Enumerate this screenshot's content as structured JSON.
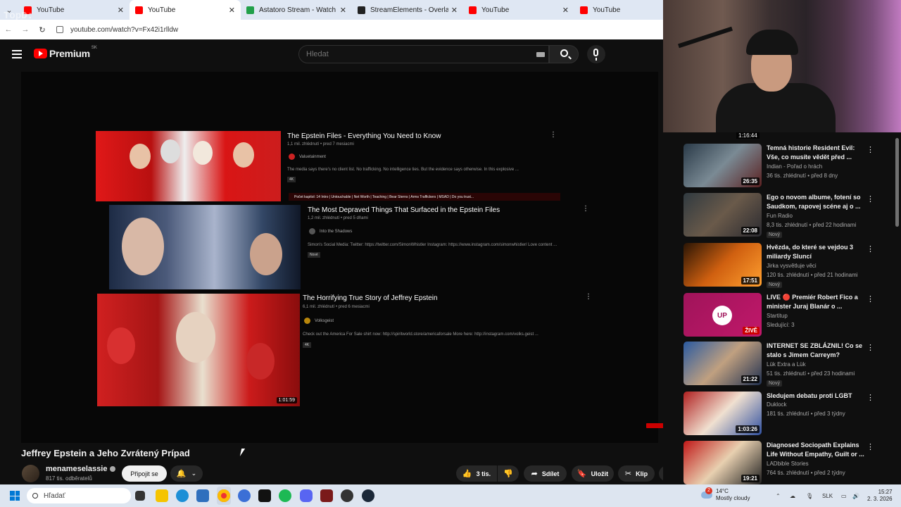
{
  "browser": {
    "tabs": [
      {
        "label": "YouTube",
        "favicon": "youtube-icon"
      },
      {
        "label": "YouTube",
        "favicon": "youtube-icon"
      },
      {
        "label": "Astatoro Stream - Watch Live o",
        "favicon": "kick-icon"
      },
      {
        "label": "StreamElements - Overlays",
        "favicon": "streamelements-icon"
      },
      {
        "label": "YouTube",
        "favicon": "youtube-icon"
      },
      {
        "label": "YouTube",
        "favicon": "youtube-icon"
      }
    ],
    "url": "youtube.com/watch?v=Fx42i1rlldw",
    "watermark": "TopD:"
  },
  "header": {
    "logo_text": "Premium",
    "region": "SK",
    "search_placeholder": "Hledat"
  },
  "player": {
    "videos": [
      {
        "title": "The Epstein Files - Everything You Need to Know",
        "meta": "1,1 mil. zhlédnutí • pred 7 mesiacmi",
        "channel": "Valuetainment",
        "desc": "The media says there's no client list. No trafficking. No intelligence ties. But the evidence says otherwise. In this explosive ...",
        "badge": "4K",
        "chapters": "Počet kapitol: 14  Intro | Untouchable | Net Worth | Teaching | Bear Sterns | Arms Traffickers | MSAD | Do you trust..."
      },
      {
        "title": "The Most Depraved Things That Surfaced in the Epstein Files",
        "meta": "1,2 mil. zhlédnutí • pred 5 dňami",
        "channel": "Into the Shadows",
        "desc": "Simon's Social Media: Twitter: https://twitter.com/SimonWhistler Instagram: https://www.instagram.com/simonwhistler/ Love content ...",
        "badge": "Nové"
      },
      {
        "title": "The Horrifying True Story of Jeffrey Epstein",
        "meta": "6,1 mil. zhlédnutí • pred 6 mesiacmi",
        "channel": "Volksgeist",
        "desc": "Check out the America For Sale shirt now: http://spiritworld.store/americaforsale More here: http://instagram.com/volks.geist ...",
        "badge": "4K",
        "duration": "1:01:59"
      }
    ]
  },
  "video": {
    "title": "Jeffrey Epstein a Jeho Zvrátený Prípad",
    "channel": "menameselassie",
    "subscribers": "817 tis. odběratelů",
    "join_label": "Připojit se",
    "likes": "3 tis.",
    "share_label": "Sdílet",
    "save_label": "Uložit",
    "clip_label": "Klip"
  },
  "sidebar": {
    "top_duration": "1:16:44",
    "items": [
      {
        "title": "Temná historie Resident Evil: Vše, co musíte vědět před ...",
        "channel": "Indian - Pořad o hrách",
        "meta": "36 tis. zhlédnutí • před 8 dny",
        "duration": "26:35",
        "new": ""
      },
      {
        "title": "Ego o novom albume, fotení so Saudkom, rapovej scéne aj o ...",
        "channel": "Fun Radio",
        "meta": "8,3 tis. zhlédnutí • před 22 hodinami",
        "duration": "22:08",
        "new": "Nový"
      },
      {
        "title": "Hvězda, do které se vejdou 3 miliardy Sluncí",
        "channel": "Jirka vysvětluje věci",
        "meta": "120 tis. zhlédnutí • před 21 hodinami",
        "duration": "17:51",
        "new": "Nový"
      },
      {
        "title": "LIVE 🔴 Premiér Robert Fico a minister Juraj Blanár o ...",
        "channel": "Startitup",
        "meta": "Sledující: 3",
        "duration": "ŽIVĚ",
        "new": "",
        "thumb_text": "UP"
      },
      {
        "title": "INTERNET SE ZBLÁZNIL! Co se stalo s Jimem Carreym?",
        "channel": "Lük Extra a Lük",
        "meta": "51 tis. zhlédnutí • před 23 hodinami",
        "duration": "21:22",
        "new": "Nový"
      },
      {
        "title": "Sledujem debatu proti LGBT",
        "channel": "Duklock",
        "meta": "181 tis. zhlédnutí • před 3 týdny",
        "duration": "1:03:26",
        "new": ""
      },
      {
        "title": "Diagnosed Sociopath Explains Life Without Empathy, Guilt or ...",
        "channel": "LADbible Stories",
        "meta": "764 tis. zhlédnutí • před 2 týdny",
        "duration": "19:21",
        "new": ""
      }
    ]
  },
  "taskbar": {
    "search_placeholder": "Hľadať",
    "weather_temp": "14°C",
    "weather_desc": "Mostly cloudy",
    "weather_badge": "2",
    "lang": "SLK",
    "time": "15:27",
    "date": "2. 3. 2026"
  },
  "colors": {
    "accent": "#ff0000",
    "background": "#0f0f0f",
    "text": "#f1f1f1"
  }
}
